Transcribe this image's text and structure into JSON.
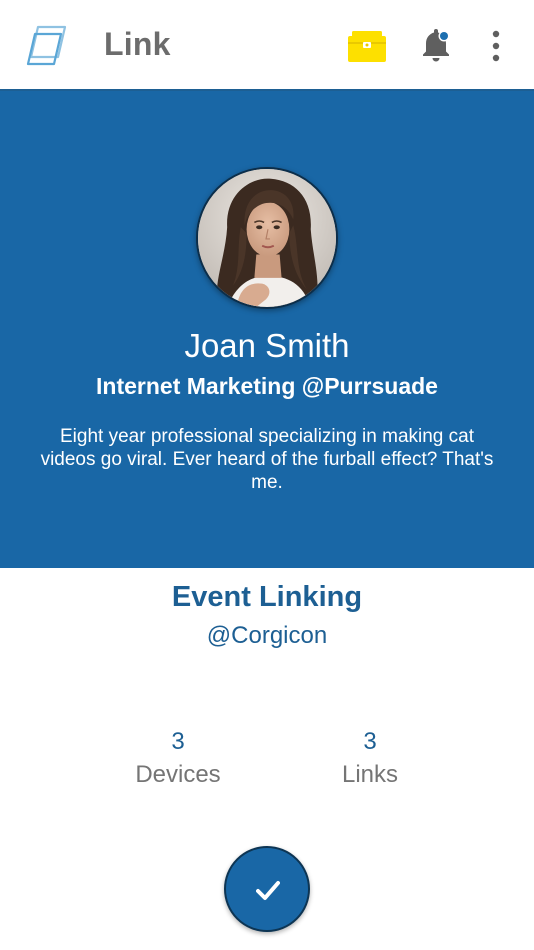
{
  "app_bar": {
    "title": "Link",
    "icons": {
      "logo": "link-logo-icon",
      "wallet": "wallet-icon",
      "notifications": "bell-icon",
      "menu": "more-vertical-icon"
    },
    "notification_dot": true
  },
  "profile": {
    "name": "Joan Smith",
    "role": "Internet Marketing @Purrsuade",
    "bio": "Eight year professional specializing in making cat videos go viral. Ever heard of the furball effect? That's me."
  },
  "event": {
    "title": "Event Linking",
    "handle": "@Corgicon"
  },
  "stats": [
    {
      "value": "3",
      "label": "Devices"
    },
    {
      "value": "3",
      "label": "Links"
    }
  ],
  "fab": {
    "icon": "checkmark-icon"
  },
  "colors": {
    "primary": "#1967a6",
    "primary_dark": "#1d5f93",
    "wallet_yellow": "#fde000",
    "title_gray": "#6c6c6c",
    "icon_gray": "#5f5f5f",
    "label_gray": "#757575"
  }
}
